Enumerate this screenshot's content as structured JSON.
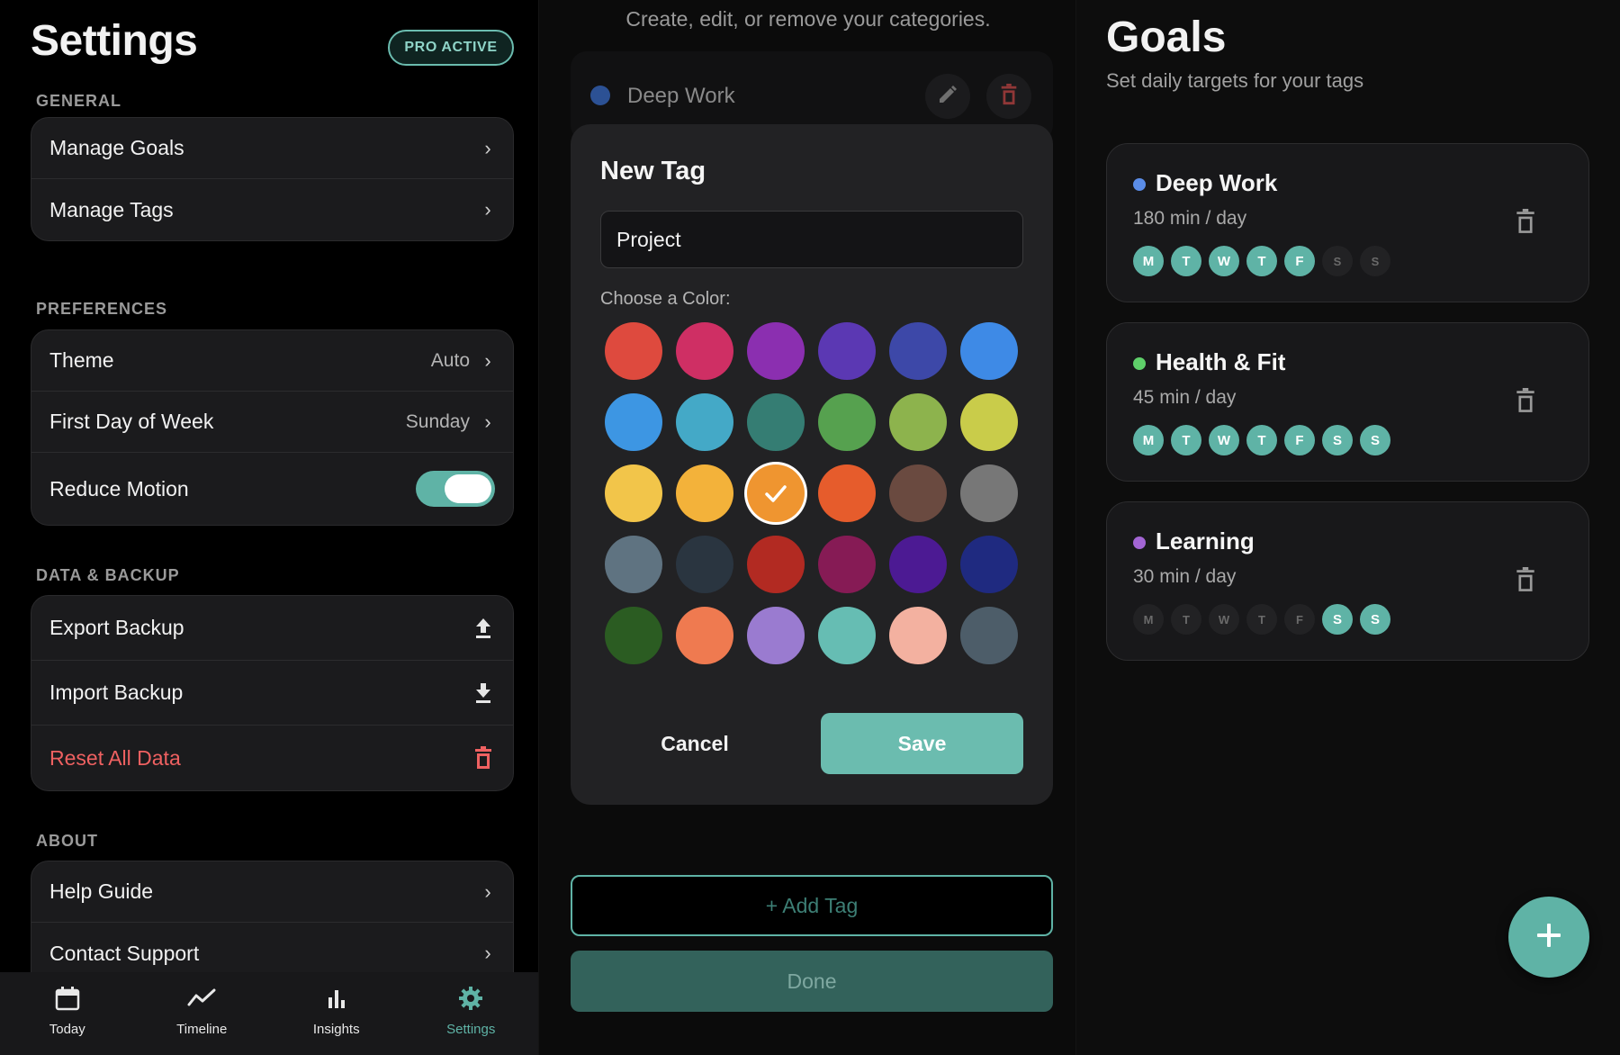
{
  "settings": {
    "title": "Settings",
    "pro_badge": "PRO ACTIVE",
    "sections": {
      "general": {
        "label": "GENERAL",
        "items": [
          {
            "label": "Manage Goals"
          },
          {
            "label": "Manage Tags"
          }
        ]
      },
      "preferences": {
        "label": "PREFERENCES",
        "theme": {
          "label": "Theme",
          "value": "Auto"
        },
        "first_day": {
          "label": "First Day of Week",
          "value": "Sunday"
        },
        "reduce_motion": {
          "label": "Reduce Motion",
          "enabled": true
        }
      },
      "data_backup": {
        "label": "DATA & BACKUP",
        "export": "Export Backup",
        "import": "Import Backup",
        "reset": "Reset All Data"
      },
      "about": {
        "label": "ABOUT",
        "help": "Help Guide",
        "contact": "Contact Support"
      }
    },
    "tabbar": [
      {
        "label": "Today",
        "icon": "calendar-icon"
      },
      {
        "label": "Timeline",
        "icon": "trend-line-icon"
      },
      {
        "label": "Insights",
        "icon": "bar-chart-icon"
      },
      {
        "label": "Settings",
        "icon": "gear-icon",
        "active": true
      }
    ]
  },
  "tags": {
    "subtitle": "Create, edit, or remove your categories.",
    "existing": [
      {
        "name": "Deep Work",
        "color": "#3a6fcf"
      }
    ],
    "modal": {
      "title": "New Tag",
      "input_value": "Project",
      "color_label": "Choose a Color:",
      "selected_color_index": 14,
      "colors": [
        "#de4a3e",
        "#cf2f64",
        "#8b2fb0",
        "#5b38b3",
        "#3d48a8",
        "#3e8ae6",
        "#3d96e3",
        "#44a9c7",
        "#357d73",
        "#56a14f",
        "#8db34d",
        "#c9cc4a",
        "#f2c54a",
        "#f3b23a",
        "#ef9530",
        "#e65c2c",
        "#6a4a40",
        "#777777",
        "#5f7381",
        "#2a3540",
        "#b22a22",
        "#861b55",
        "#4c1a93",
        "#1f2a80",
        "#2b5c22",
        "#ef7a50",
        "#9a7bd0",
        "#66bdb3",
        "#f3b1a0",
        "#4d5d69"
      ],
      "cancel": "Cancel",
      "save": "Save"
    },
    "add_button": "+ Add Tag",
    "done_button": "Done"
  },
  "goals": {
    "title": "Goals",
    "subtitle": "Set daily targets for your tags",
    "day_letters": [
      "M",
      "T",
      "W",
      "T",
      "F",
      "S",
      "S"
    ],
    "items": [
      {
        "name": "Deep Work",
        "color": "#5b8de8",
        "target": "180 min / day",
        "days": [
          true,
          true,
          true,
          true,
          true,
          false,
          false
        ]
      },
      {
        "name": "Health & Fit",
        "color": "#5fd06a",
        "target": "45 min / day",
        "days": [
          true,
          true,
          true,
          true,
          true,
          true,
          true
        ]
      },
      {
        "name": "Learning",
        "color": "#a365d4",
        "target": "30 min / day",
        "days": [
          false,
          false,
          false,
          false,
          false,
          true,
          true
        ]
      }
    ]
  }
}
